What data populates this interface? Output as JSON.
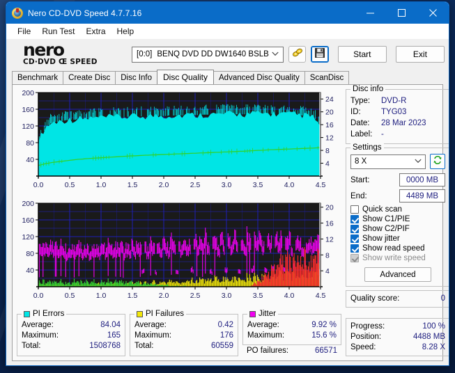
{
  "window": {
    "title": "Nero CD-DVD Speed 4.7.7.16",
    "icon": "nero-disc-icon",
    "minimize_label": "—",
    "maximize_label": "□",
    "close_label": "✕"
  },
  "menu": {
    "items": [
      "File",
      "Run Test",
      "Extra",
      "Help"
    ]
  },
  "logo": {
    "word": "nero",
    "sub": "CD·DVD Œ SPEED"
  },
  "toolbar": {
    "drive_index": "[0:0]",
    "drive_name": "BENQ DVD DD DW1640 BSLB",
    "caret": "⌄",
    "eject_icon": "disc-eject-icon",
    "save_icon": "floppy-save-icon",
    "start_label": "Start",
    "exit_label": "Exit"
  },
  "tabs": {
    "items": [
      {
        "label": "Benchmark",
        "active": false
      },
      {
        "label": "Create Disc",
        "active": false
      },
      {
        "label": "Disc Info",
        "active": false
      },
      {
        "label": "Disc Quality",
        "active": true
      },
      {
        "label": "Advanced Disc Quality",
        "active": false
      },
      {
        "label": "ScanDisc",
        "active": false
      }
    ]
  },
  "disc_info": {
    "legend": "Disc info",
    "type_label": "Type:",
    "type_value": "DVD-R",
    "id_label": "ID:",
    "id_value": "TYG03",
    "date_label": "Date:",
    "date_value": "28 Mar 2023",
    "label_label": "Label:",
    "label_value": "-"
  },
  "settings": {
    "legend": "Settings",
    "speed_value": "8 X",
    "caret": "⌄",
    "refresh_icon": "refresh-icon",
    "start_label": "Start:",
    "start_value": "0000 MB",
    "end_label": "End:",
    "end_value": "4489 MB",
    "checkboxes": [
      {
        "label": "Quick scan",
        "checked": false,
        "disabled": false
      },
      {
        "label": "Show C1/PIE",
        "checked": true,
        "disabled": false
      },
      {
        "label": "Show C2/PIF",
        "checked": true,
        "disabled": false
      },
      {
        "label": "Show jitter",
        "checked": true,
        "disabled": false
      },
      {
        "label": "Show read speed",
        "checked": true,
        "disabled": false
      },
      {
        "label": "Show write speed",
        "checked": true,
        "disabled": true
      }
    ],
    "advanced_label": "Advanced"
  },
  "quality": {
    "label": "Quality score:",
    "value": "0"
  },
  "progress": {
    "progress_label": "Progress:",
    "progress_value": "100 %",
    "position_label": "Position:",
    "position_value": "4488 MB",
    "speed_label": "Speed:",
    "speed_value": "8.28 X"
  },
  "stats": {
    "pi_errors": {
      "legend": "PI Errors",
      "color": "#00e5e5",
      "rows": [
        {
          "k": "Average:",
          "v": "84.04"
        },
        {
          "k": "Maximum:",
          "v": "165"
        },
        {
          "k": "Total:",
          "v": "1508768"
        }
      ]
    },
    "pi_failures": {
      "legend": "PI Failures",
      "color": "#f2e70a",
      "rows": [
        {
          "k": "Average:",
          "v": "0.42"
        },
        {
          "k": "Maximum:",
          "v": "176"
        },
        {
          "k": "Total:",
          "v": "60559"
        }
      ]
    },
    "jitter": {
      "legend": "Jitter",
      "color": "#f000f0",
      "rows": [
        {
          "k": "Average:",
          "v": "9.92 %"
        },
        {
          "k": "Maximum:",
          "v": "15.6 %"
        }
      ],
      "po_label": "PO failures:",
      "po_value": "66571"
    }
  },
  "chart_data": [
    {
      "type": "area",
      "name": "PI Errors / Read speed",
      "title": "",
      "xlabel": "",
      "ylabel": "",
      "xticks": [
        "0.0",
        "0.5",
        "1.0",
        "1.5",
        "2.0",
        "2.5",
        "3.0",
        "3.5",
        "4.0",
        "4.5"
      ],
      "xlim": [
        0,
        4.5
      ],
      "left_yticks": [
        "40",
        "80",
        "120",
        "160",
        "200"
      ],
      "left_ylim": [
        0,
        200
      ],
      "right_yticks": [
        "4",
        "8",
        "12",
        "16",
        "20",
        "24"
      ],
      "right_ylim": [
        0,
        26
      ],
      "grid": true,
      "bg": "#1a1a1a",
      "grid_color": "#2020c0",
      "series": [
        {
          "name": "PI Errors",
          "color": "#00e5e5",
          "axis": "left",
          "kind": "area",
          "values": [
            78,
            96,
            108,
            118,
            122,
            126,
            128,
            130,
            131,
            132,
            133,
            134,
            134,
            135,
            135,
            136,
            136,
            137,
            137,
            138,
            138,
            138,
            139,
            139,
            139,
            140,
            140,
            140,
            140,
            141,
            141,
            141,
            141,
            141,
            142,
            142,
            142,
            142,
            142,
            143,
            143,
            143,
            143,
            143,
            144,
            144,
            144,
            144,
            144,
            144,
            145,
            145,
            145,
            145,
            145,
            145,
            146,
            146,
            146,
            146,
            146,
            146,
            146,
            147,
            147,
            147,
            147,
            147,
            147,
            147,
            147,
            148,
            148,
            148,
            148,
            148,
            148,
            148,
            148,
            148,
            148,
            149,
            149,
            149,
            149,
            149,
            149,
            149,
            149,
            149,
            149,
            148,
            148,
            148,
            148,
            148,
            147,
            147,
            147,
            146,
            146,
            145,
            144,
            143,
            142,
            140,
            136,
            128,
            112
          ]
        },
        {
          "name": "Read speed",
          "color": "#2fd32f",
          "axis": "right",
          "kind": "line",
          "values": [
            3.3,
            3.5,
            3.7,
            3.9,
            4.0,
            4.2,
            4.3,
            4.4,
            4.5,
            4.6,
            4.7,
            4.8,
            4.9,
            5.0,
            5.1,
            5.2,
            5.25,
            5.3,
            5.4,
            5.45,
            5.5,
            5.55,
            5.6,
            5.65,
            5.7,
            5.75,
            5.8,
            5.85,
            5.9,
            5.95,
            6.0,
            6.05,
            6.1,
            6.15,
            6.2,
            6.25,
            6.3,
            6.3,
            6.35,
            6.4,
            6.45,
            6.5,
            6.5,
            6.55,
            6.6,
            6.6,
            6.65,
            6.7,
            6.7,
            6.75,
            6.8,
            6.8,
            6.85,
            6.9,
            6.9,
            6.95,
            7.0,
            7.0,
            7.05,
            7.1,
            7.1,
            7.15,
            7.2,
            7.2,
            7.25,
            7.3,
            7.3,
            7.35,
            7.4,
            7.4,
            7.45,
            7.5,
            7.5,
            7.55,
            7.6,
            7.6,
            7.65,
            7.7,
            7.7,
            7.75,
            7.8,
            7.85,
            7.9,
            7.95,
            8.0,
            8.0,
            8.05,
            8.1,
            8.15,
            8.2,
            8.2,
            8.25,
            8.3,
            8.3,
            8.35,
            8.4,
            8.4,
            8.45,
            8.5,
            8.5,
            8.55,
            8.6,
            8.6,
            8.65,
            8.7,
            8.7,
            8.75,
            8.8,
            8.85
          ]
        }
      ]
    },
    {
      "type": "area",
      "name": "Jitter / PI Failures",
      "title": "",
      "xlabel": "",
      "ylabel": "",
      "xticks": [
        "0.0",
        "0.5",
        "1.0",
        "1.5",
        "2.0",
        "2.5",
        "3.0",
        "3.5",
        "4.0",
        "4.5"
      ],
      "xlim": [
        0,
        4.5
      ],
      "left_yticks": [
        "40",
        "80",
        "120",
        "160",
        "200"
      ],
      "left_ylim": [
        0,
        200
      ],
      "right_yticks": [
        "4",
        "8",
        "12",
        "16",
        "20"
      ],
      "right_ylim": [
        0,
        21
      ],
      "grid": true,
      "bg": "#1a1a1a",
      "grid_color": "#2020c0",
      "series": [
        {
          "name": "Jitter",
          "color": "#f000f0",
          "axis": "right",
          "kind": "spikes",
          "values": [
            9.5,
            10.2,
            9.8,
            10.5,
            9.6,
            10.8,
            9.9,
            10.1,
            9.4,
            10.6,
            9.7,
            8.9,
            9.3,
            10.0,
            9.2,
            9.8,
            10.4,
            9.1,
            9.6,
            10.2,
            8.8,
            9.5,
            10.0,
            9.3,
            9.9,
            10.6,
            9.2,
            10.8,
            9.7,
            9.4,
            10.1,
            9.8,
            10.5,
            9.0,
            10.2,
            9.6,
            11.0,
            9.3,
            10.4,
            9.9,
            4.5,
            10.6,
            9.5,
            11.2,
            10.0,
            4.0,
            10.8,
            9.7,
            11.5,
            10.3,
            9.2,
            12.0,
            10.5,
            4.2,
            11.8,
            10.1,
            12.4,
            9.8,
            11.0,
            4.6,
            12.8,
            10.4,
            11.6,
            9.9,
            13.2,
            10.7,
            4.1,
            12.2,
            11.4,
            10.0,
            13.8,
            11.0,
            4.4,
            12.6,
            10.8,
            13.0,
            11.5,
            4.3,
            12.0,
            10.6,
            13.5,
            11.8,
            4.8,
            12.4,
            11.2,
            13.9,
            10.9,
            4.5,
            12.8,
            11.6,
            5.0,
            13.2,
            11.0,
            12.5,
            5.2,
            11.4,
            12.9,
            10.5,
            5.6,
            12.2,
            11.8,
            10.2,
            6.0,
            11.5,
            12.0,
            10.8,
            11.2,
            11.6,
            11.4
          ]
        },
        {
          "name": "PI Failures",
          "color": "#f2e70a",
          "axis": "right",
          "kind": "bars",
          "values": [
            0.6,
            0.5,
            0.4,
            0.7,
            0.5,
            0.3,
            0.6,
            0.4,
            0.5,
            0.8,
            0.4,
            0.6,
            0.3,
            0.5,
            0.7,
            0.4,
            0.6,
            0.5,
            0.3,
            0.7,
            0.5,
            0.4,
            0.6,
            0.8,
            0.5,
            0.4,
            0.7,
            0.6,
            0.5,
            0.9,
            0.6,
            0.4,
            0.7,
            0.5,
            0.8,
            0.6,
            1.0,
            0.7,
            0.5,
            0.9,
            0.6,
            1.1,
            0.8,
            0.6,
            1.2,
            0.9,
            0.7,
            1.3,
            1.0,
            0.8,
            1.4,
            1.1,
            0.9,
            1.5,
            1.2,
            1.0,
            1.6,
            1.3,
            1.1,
            1.7,
            1.4,
            1.2,
            1.8,
            1.5,
            1.3,
            1.9,
            1.6,
            1.4,
            2.0,
            1.7,
            1.5,
            2.1,
            1.8,
            1.6,
            2.2,
            1.9,
            1.7,
            2.3,
            2.0,
            1.8,
            2.4,
            2.1,
            1.9,
            2.5,
            2.2,
            2.0,
            2.6,
            2.3,
            2.1,
            2.8,
            2.4,
            2.2,
            3.0,
            2.6,
            2.4,
            3.2,
            2.8,
            2.6,
            3.5,
            3.0,
            2.8,
            3.8,
            3.2,
            3.0,
            4.0,
            3.5,
            3.2,
            4.2,
            3.6
          ]
        },
        {
          "name": "PO Failures",
          "color": "#ff2d2d",
          "axis": "right",
          "kind": "bars",
          "values": [
            0,
            0,
            0,
            0,
            0,
            0,
            0,
            0,
            0,
            0,
            0,
            0,
            0,
            0,
            0,
            0,
            0,
            0,
            0,
            0,
            0,
            0,
            0,
            0,
            0,
            0,
            0,
            0,
            0,
            0,
            0,
            0,
            0,
            0,
            0,
            0,
            0,
            0,
            0,
            0,
            0,
            0,
            0,
            0,
            0,
            0,
            0,
            0,
            0,
            0,
            0,
            0,
            0,
            0,
            0,
            0,
            0,
            0,
            0,
            0,
            0,
            0,
            0,
            0,
            0,
            0,
            0,
            0,
            0,
            0,
            0,
            0,
            0,
            0,
            0,
            0,
            0,
            0,
            0,
            0,
            0,
            0,
            0.5,
            0.8,
            1.2,
            1.6,
            2.2,
            2.8,
            3.4,
            4.0,
            4.4,
            4.8,
            5.2,
            5.6,
            5.9,
            6.2,
            6.4,
            6.6,
            6.8,
            6.9,
            7.0,
            7.1,
            7.2,
            7.2,
            7.1,
            7.0,
            6.8,
            6.5,
            6.0
          ]
        },
        {
          "name": "C1 low band",
          "color": "#34d634",
          "axis": "right",
          "kind": "bars",
          "values": [
            1.1,
            0.9,
            1.3,
            0.8,
            1.2,
            1.0,
            1.4,
            0.9,
            1.1,
            1.3,
            0.8,
            1.2,
            1.0,
            0.9,
            1.4,
            1.1,
            0.8,
            1.3,
            1.0,
            1.2,
            0.9,
            1.1,
            1.3,
            0.8,
            1.0,
            1.2,
            0.9,
            1.4,
            1.1,
            0.8,
            1.2,
            1.0,
            1.3,
            0.9,
            1.1,
            0.8,
            1.2,
            1.0,
            0.9,
            1.1,
            0.7,
            0.9,
            0.8,
            0.6,
            0.7,
            0.5,
            0.6,
            0.4,
            0.5,
            0.3,
            0.4,
            0.3,
            0.2,
            0.3,
            0.2,
            0.2,
            0.1,
            0.2,
            0.1,
            0.1,
            0,
            0,
            0,
            0,
            0,
            0,
            0,
            0,
            0,
            0,
            0,
            0,
            0,
            0,
            0,
            0,
            0,
            0,
            0,
            0,
            0,
            0,
            0,
            0,
            0,
            0,
            0,
            0,
            0,
            0,
            0,
            0,
            0,
            0,
            0,
            0,
            0,
            0,
            0,
            0,
            0,
            0,
            0,
            0,
            0,
            0,
            0,
            0,
            0,
            0,
            0
          ]
        }
      ]
    }
  ]
}
